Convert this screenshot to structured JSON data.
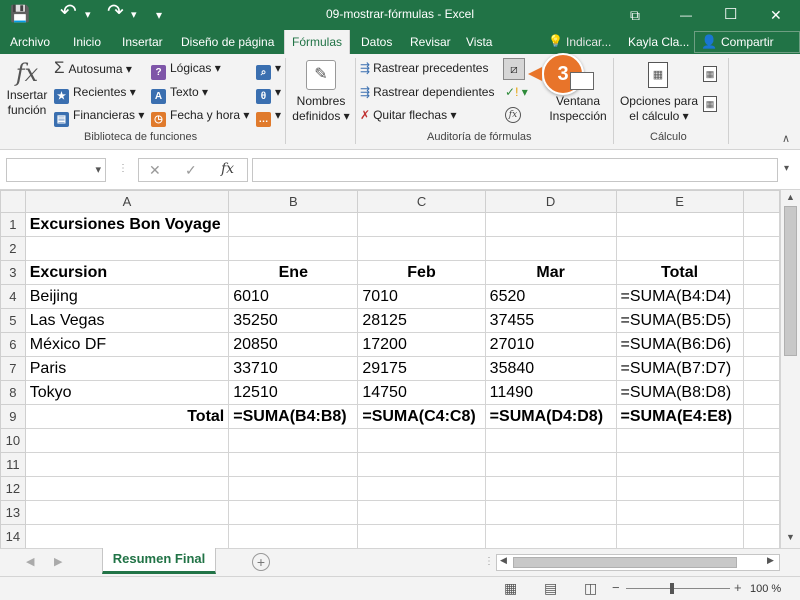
{
  "titlebar": {
    "title": "09-mostrar-fórmulas  -  Excel",
    "save_icon": "💾",
    "undo_icon": "↶",
    "redo_icon": "↷",
    "customize_icon": "▾",
    "ribbon_options_icon": "⧉",
    "minimize_icon": "—",
    "maximize_icon": "☐",
    "close_icon": "✕"
  },
  "tabs": [
    "Archivo",
    "Inicio",
    "Insertar",
    "Diseño de página",
    "Fórmulas",
    "Datos",
    "Revisar",
    "Vista"
  ],
  "tellme": "Indicar...",
  "user": "Kayla Cla...",
  "share": "Compartir",
  "ribbon": {
    "insert_function": {
      "line1": "Insertar",
      "line2": "función",
      "icon": "fx"
    },
    "autosum": "Autosuma",
    "recent": "Recientes",
    "financial": "Financieras",
    "logical": "Lógicas",
    "text": "Texto",
    "datetime": "Fecha y hora",
    "defined_names": {
      "line1": "Nombres",
      "line2": "definidos"
    },
    "trace_precedents": "Rastrear precedentes",
    "trace_dependents": "Rastrear dependientes",
    "remove_arrows": "Quitar flechas",
    "watch_window": {
      "line1": "Ventana",
      "line2": "Inspección"
    },
    "calc_options": {
      "line1": "Opciones para",
      "line2": "el cálculo"
    },
    "group_library": "Biblioteca de funciones",
    "group_audit": "Auditoría de fórmulas",
    "group_calc": "Cálculo",
    "step_badge": "3"
  },
  "formula_bar": {
    "name_box": "",
    "fx": "fx",
    "cancel": "✕",
    "enter": "✓",
    "content": ""
  },
  "columns": [
    "A",
    "B",
    "C",
    "D",
    "E"
  ],
  "rows": [
    {
      "n": "1",
      "cells": [
        "Excursiones Bon Voyage",
        "",
        "",
        "",
        ""
      ]
    },
    {
      "n": "2",
      "cells": [
        "",
        "",
        "",
        "",
        ""
      ]
    },
    {
      "n": "3",
      "cells": [
        "Excursion",
        "Ene",
        "Feb",
        "Mar",
        "Total"
      ]
    },
    {
      "n": "4",
      "cells": [
        "Beijing",
        "6010",
        "7010",
        "6520",
        "=SUMA(B4:D4)"
      ]
    },
    {
      "n": "5",
      "cells": [
        "Las Vegas",
        "35250",
        "28125",
        "37455",
        "=SUMA(B5:D5)"
      ]
    },
    {
      "n": "6",
      "cells": [
        "México DF",
        "20850",
        "17200",
        "27010",
        "=SUMA(B6:D6)"
      ]
    },
    {
      "n": "7",
      "cells": [
        "Paris",
        "33710",
        "29175",
        "35840",
        "=SUMA(B7:D7)"
      ]
    },
    {
      "n": "8",
      "cells": [
        "Tokyo",
        "12510",
        "14750",
        "11490",
        "=SUMA(B8:D8)"
      ]
    },
    {
      "n": "9",
      "cells": [
        "Total",
        "=SUMA(B4:B8)",
        "=SUMA(C4:C8)",
        "=SUMA(D4:D8)",
        "=SUMA(E4:E8)"
      ]
    },
    {
      "n": "10",
      "cells": [
        "",
        "",
        "",
        "",
        ""
      ]
    },
    {
      "n": "11",
      "cells": [
        "",
        "",
        "",
        "",
        ""
      ]
    },
    {
      "n": "12",
      "cells": [
        "",
        "",
        "",
        "",
        ""
      ]
    },
    {
      "n": "13",
      "cells": [
        "",
        "",
        "",
        "",
        ""
      ]
    },
    {
      "n": "14",
      "cells": [
        "",
        "",
        "",
        "",
        ""
      ]
    }
  ],
  "sheet_tab": "Resumen Final",
  "status": {
    "zoom": "100 %",
    "zoom_minus": "−",
    "zoom_plus": "+"
  },
  "colors": {
    "accent": "#217346",
    "badge": "#e8742a"
  }
}
